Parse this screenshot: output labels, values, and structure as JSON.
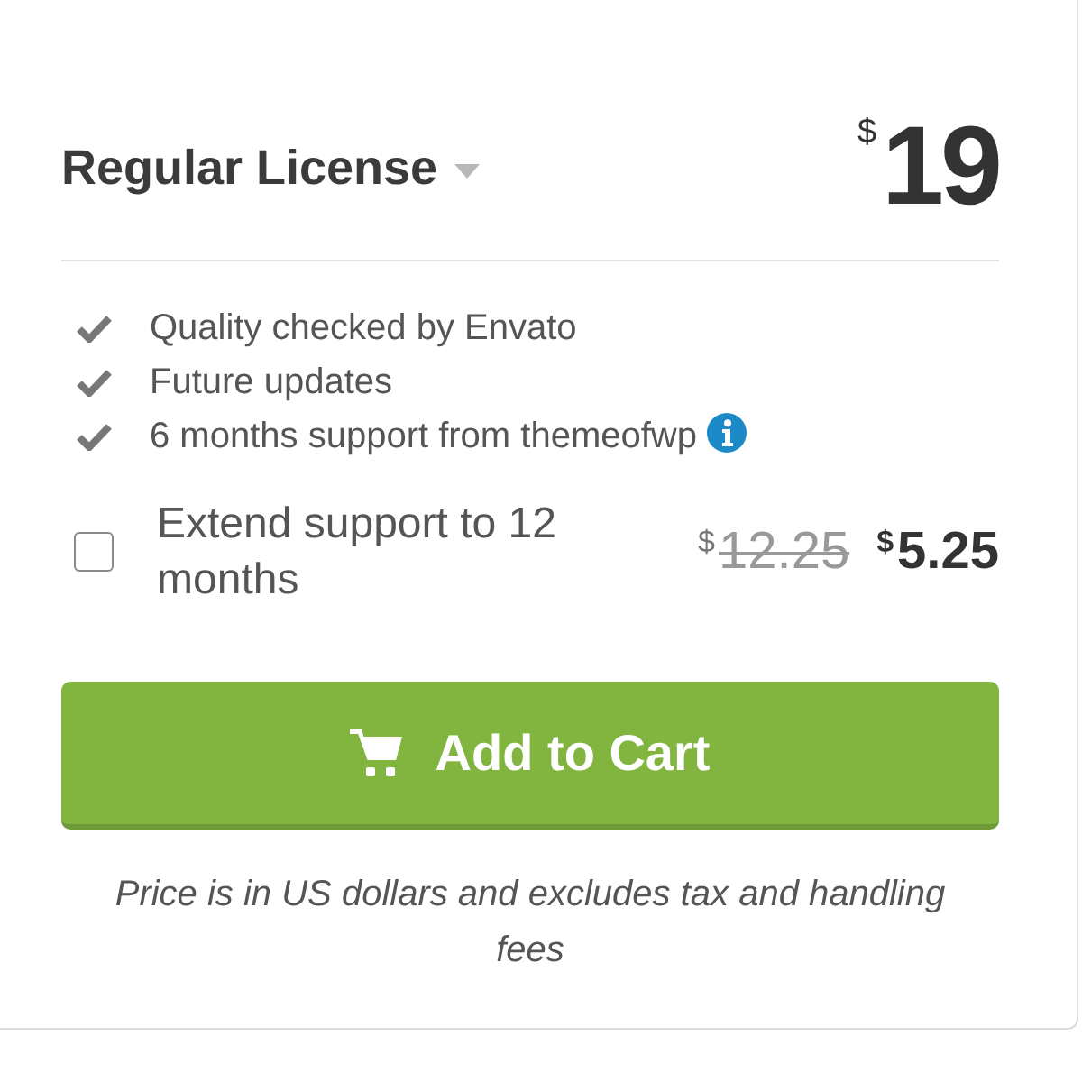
{
  "license": {
    "title": "Regular License",
    "currency": "$",
    "amount": "19"
  },
  "features": [
    {
      "text": "Quality checked by Envato",
      "info": false
    },
    {
      "text": "Future updates",
      "info": false
    },
    {
      "text": "6 months support from themeofwp",
      "info": true
    }
  ],
  "extend_support": {
    "label": "Extend support to 12 months",
    "checked": false,
    "old_currency": "$",
    "old_price": "12.25",
    "currency": "$",
    "price": "5.25"
  },
  "button": {
    "label": "Add to Cart"
  },
  "note": "Price is in US dollars and excludes tax and handling fees"
}
